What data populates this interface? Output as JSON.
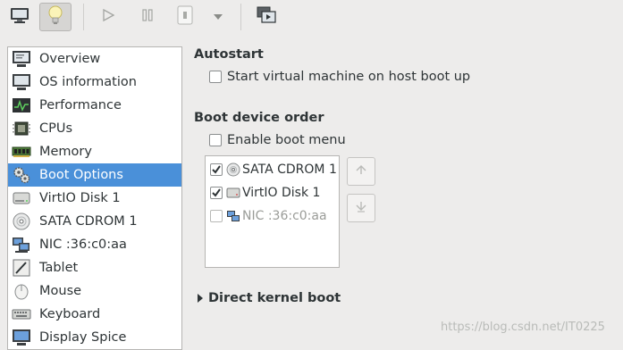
{
  "toolbar": {
    "buttons": [
      {
        "name": "console-view",
        "icon": "monitor-icon"
      },
      {
        "name": "details-view",
        "icon": "lightbulb-icon",
        "active": true
      },
      {
        "name": "run",
        "icon": "play-icon"
      },
      {
        "name": "pause",
        "icon": "pause-icon"
      },
      {
        "name": "shutdown",
        "icon": "power-icon"
      },
      {
        "name": "shutdown-menu",
        "icon": "chevron-down-icon"
      },
      {
        "name": "fullscreen",
        "icon": "screens-icon"
      }
    ]
  },
  "sidebar": {
    "items": [
      {
        "label": "Overview",
        "icon": "monitor-info-icon"
      },
      {
        "label": "OS information",
        "icon": "monitor-icon"
      },
      {
        "label": "Performance",
        "icon": "performance-graph-icon"
      },
      {
        "label": "CPUs",
        "icon": "cpu-chip-icon"
      },
      {
        "label": "Memory",
        "icon": "memory-module-icon"
      },
      {
        "label": "Boot Options",
        "icon": "gears-icon",
        "selected": true
      },
      {
        "label": "VirtIO Disk 1",
        "icon": "hard-disk-icon"
      },
      {
        "label": "SATA CDROM 1",
        "icon": "cdrom-icon"
      },
      {
        "label": "NIC :36:c0:aa",
        "icon": "network-icon"
      },
      {
        "label": "Tablet",
        "icon": "tablet-icon"
      },
      {
        "label": "Mouse",
        "icon": "mouse-icon"
      },
      {
        "label": "Keyboard",
        "icon": "keyboard-icon"
      },
      {
        "label": "Display Spice",
        "icon": "display-icon"
      }
    ]
  },
  "autostart": {
    "heading": "Autostart",
    "checkbox_label": "Start virtual machine on host boot up",
    "checked": false
  },
  "boot_order": {
    "heading": "Boot device order",
    "enable_menu_label": "Enable boot menu",
    "enable_menu_checked": false,
    "devices": [
      {
        "label": "SATA CDROM 1",
        "checked": true,
        "enabled": true,
        "icon": "cdrom-icon"
      },
      {
        "label": "VirtIO Disk 1",
        "checked": true,
        "enabled": true,
        "icon": "hard-disk-icon"
      },
      {
        "label": "NIC :36:c0:aa",
        "checked": false,
        "enabled": false,
        "icon": "network-icon"
      }
    ],
    "move_up_icon": "arrow-up-icon",
    "move_down_icon": "arrow-down-icon"
  },
  "direct_kernel": {
    "label": "Direct kernel boot",
    "expanded": false
  },
  "watermark": "https://blog.csdn.net/IT0225",
  "colors": {
    "selection": "#4a90d9",
    "background": "#edeceb"
  }
}
